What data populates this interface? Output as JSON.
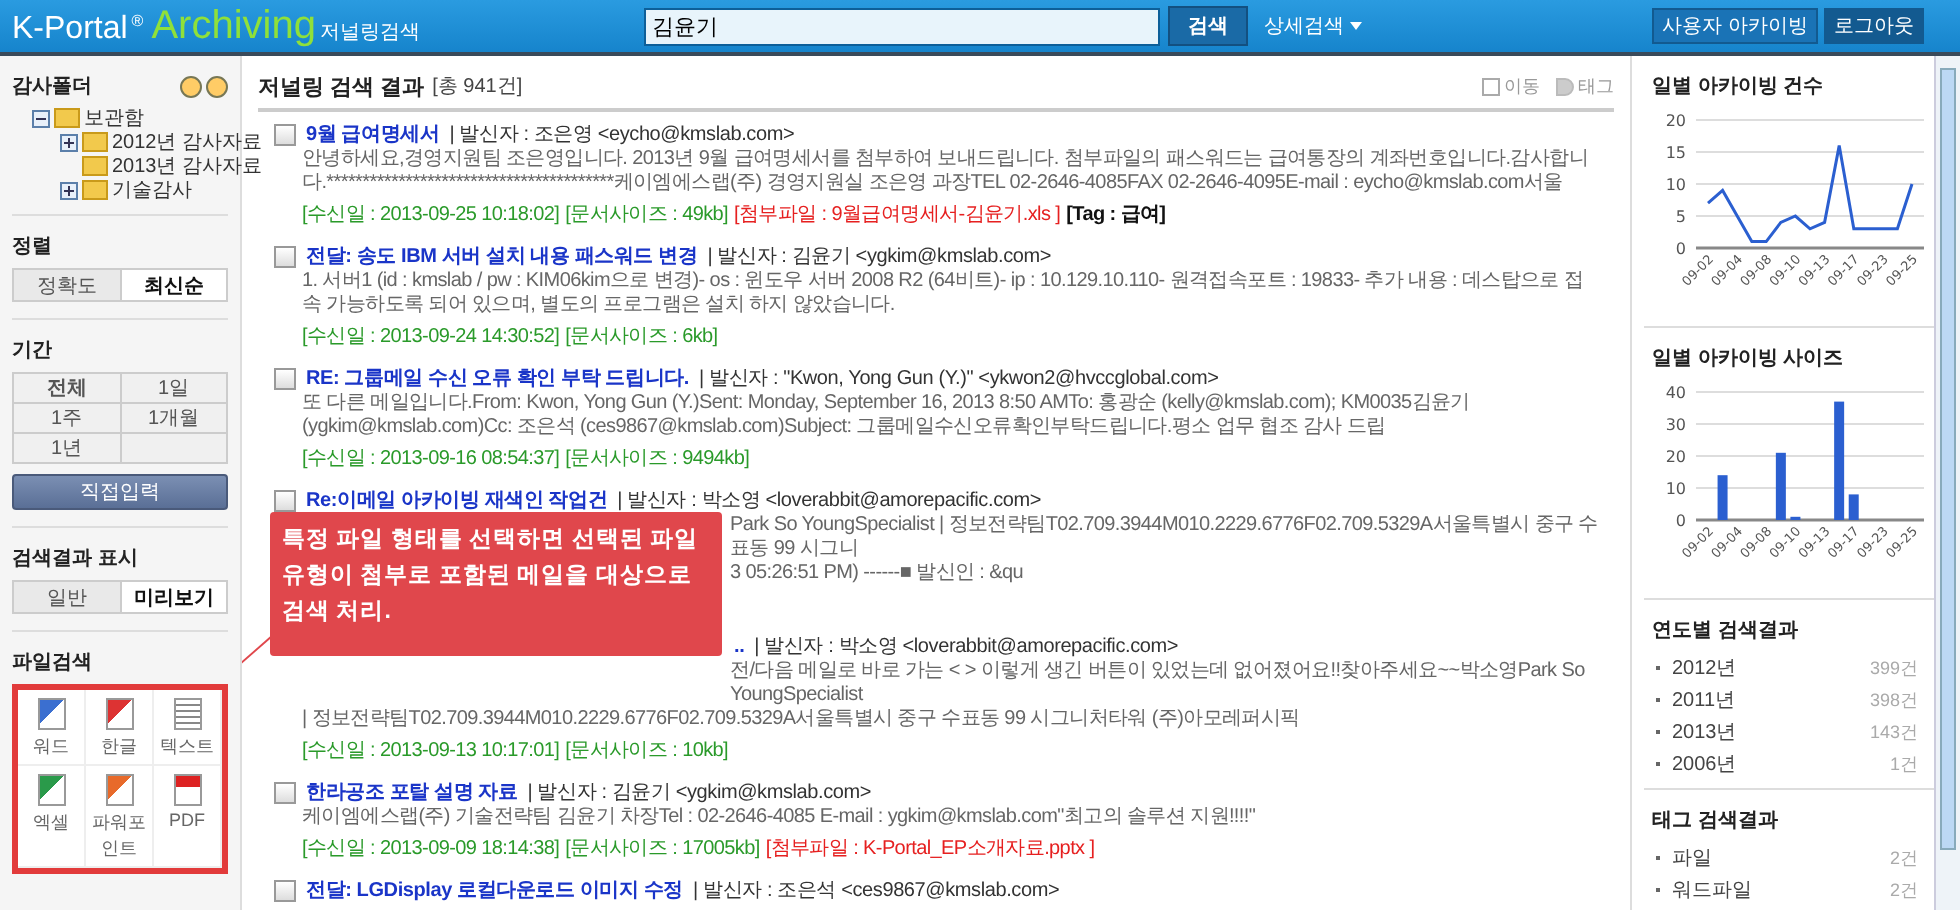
{
  "header": {
    "logo": {
      "brand": "K-Portal",
      "mark": "®",
      "product": "Archiving",
      "subtitle": "저널링검색"
    },
    "search": {
      "value": "김윤기"
    },
    "search_button": "검색",
    "advanced_search": "상세검색",
    "buttons": [
      "사용자 아카이빙",
      "로그아웃"
    ]
  },
  "sidebar": {
    "folders": {
      "title": "감사폴더",
      "tree": [
        {
          "label": "보관함",
          "expanded": true,
          "children": [
            {
              "label": "2012년 감사자료",
              "expanded": false
            },
            {
              "label": "2013년 감사자료"
            },
            {
              "label": "기술감사",
              "expanded": false
            }
          ]
        }
      ]
    },
    "sort": {
      "title": "정렬",
      "options": [
        {
          "label": "정확도",
          "selected": false
        },
        {
          "label": "최신순",
          "selected": true
        }
      ]
    },
    "period": {
      "title": "기간",
      "options": [
        {
          "label": "전체",
          "selected": true
        },
        {
          "label": "1일",
          "selected": false
        },
        {
          "label": "1주",
          "selected": false
        },
        {
          "label": "1개월",
          "selected": false
        },
        {
          "label": "1년",
          "selected": false
        }
      ],
      "custom_button": "직접입력"
    },
    "display": {
      "title": "검색결과 표시",
      "options": [
        {
          "label": "일반",
          "selected": false
        },
        {
          "label": "미리보기",
          "selected": true
        }
      ]
    },
    "file_search": {
      "title": "파일검색",
      "types": [
        {
          "kind": "word",
          "label": "워드"
        },
        {
          "kind": "hangul",
          "label": "한글"
        },
        {
          "kind": "text",
          "label": "텍스트"
        },
        {
          "kind": "excel",
          "label": "엑셀"
        },
        {
          "kind": "powerpoint",
          "label": "파워포인트"
        },
        {
          "kind": "pdf",
          "label": "PDF"
        }
      ]
    }
  },
  "main": {
    "title": "저널링 검색 결과",
    "count": "[총 941건]",
    "actions": [
      "이동",
      "태그"
    ],
    "results": [
      {
        "title": "9월 급여명세서",
        "checked": false,
        "sender": "| 발신자 : 조은영 <eycho@kmslab.com>",
        "body": [
          {
            "text": "안녕하세요,경영지원팀 조은영입니다. 2013년 9월 급여명세서를 첨부하여 보내드립니다. 첨부파일의 패스워드는 급여통장의 계좌번호입니다.감사합니다.****************************************케이엠에스랩(주) 경영지원실 조은영 과장TEL 02-2646-4085FAX 02-2646-4095E-mail : eycho@kmslab.com서울"
          }
        ],
        "meta": [
          {
            "kind": "info",
            "text": "[수신일 : 2013-09-25 10:18:02]"
          },
          {
            "kind": "info",
            "text": "[문서사이즈 : 49kb]"
          },
          {
            "kind": "attachment",
            "text": "[첨부파일 : 9월급여명세서-김윤기.xls ]"
          },
          {
            "kind": "tag",
            "text": "[Tag : 급여]"
          }
        ]
      },
      {
        "title": "전달: 송도 IBM 서버 설치 내용 패스워드 변경",
        "checked": false,
        "sender": "| 발신자 : 김윤기 <ygkim@kmslab.com>",
        "body": [
          {
            "text": "1. 서버1 (id : kmslab / pw : KIM06kim으로 변경)- os : 윈도우 서버 2008 R2 (64비트)- ip : 10.129.10.110- 원격접속포트 : 19833- 추가 내용 : 데스탑으로 접속 가능하도록 되어 있으며, 별도의 프로그램은 설치 하지 않았습니다."
          }
        ],
        "meta": [
          {
            "kind": "info",
            "text": "[수신일 : 2013-09-24 14:30:52]"
          },
          {
            "kind": "info",
            "text": "[문서사이즈 : 6kb]"
          }
        ]
      },
      {
        "title": "RE: 그룹메일 수신 오류 확인 부탁 드립니다.",
        "checked": false,
        "sender": "| 발신자 : \"Kwon, Yong Gun (Y.)\" <ykwon2@hvccglobal.com>",
        "body": [
          {
            "text": "또 다른 메일입니다.From: Kwon, Yong Gun (Y.)Sent: Monday, September 16, 2013 8:50 AMTo: 홍광순 (kelly@kmslab.com); KM0035김윤기 (ygkim@kmslab.com)Cc: 조은석 (ces9867@kmslab.com)Subject: 그룹메일수신오류확인부탁드립니다.평소 업무 협조 감사 드립"
          }
        ],
        "meta": [
          {
            "kind": "info",
            "text": "[수신일 : 2013-09-16 08:54:37]"
          },
          {
            "kind": "info",
            "text": "[문서사이즈 : 9494kb]"
          }
        ]
      },
      {
        "kind": "callout_anchor",
        "title": "Re:이메일 아카이빙 재색인 작업건",
        "checked": false,
        "sender": "| 발신자 : 박소영 <loverabbit@amorepacific.com>",
        "body": [
          {
            "text": "Park So YoungSpecialist | 정보전략팀T02.709.3944M010.2229.6776F02.709.5329A서울특별시 중구 수표동 99 시그니",
            "kind": "after_callout"
          },
          {
            "text": "3 05:26:51 PM) ------■ 발신인 : &qu",
            "kind": "after_callout"
          }
        ]
      },
      {
        "kind": "after_callout",
        "title": "..",
        "sender": "| 발신자 : 박소영 <loverabbit@amorepacific.com>",
        "body": [
          {
            "text": "전/다음 메일로 바로 가는 < > 이렇게 생긴 버튼이 있었는데 없어졌어요!!찾아주세요~~박소영Park So YoungSpecialist",
            "kind": "after_callout"
          },
          {
            "text": "| 정보전략팀T02.709.3944M010.2229.6776F02.709.5329A서울특별시 중구 수표동 99 시그니처타워 (주)아모레퍼시픽"
          }
        ],
        "meta": [
          {
            "kind": "info",
            "text": "[수신일 : 2013-09-13 10:17:01]"
          },
          {
            "kind": "info",
            "text": "[문서사이즈 : 10kb]"
          }
        ]
      },
      {
        "title": "한라공조 포탈 설명 자료",
        "checked": false,
        "sender": "| 발신자 : 김윤기 <ygkim@kmslab.com>",
        "body": [
          {
            "text": "케이엠에스랩(주) 기술전략팀 김윤기 차장Tel : 02-2646-4085 E-mail : ygkim@kmslab.com\"최고의 솔루션 지원!!!!\""
          }
        ],
        "meta": [
          {
            "kind": "info",
            "text": "[수신일 : 2013-09-09 18:14:38]"
          },
          {
            "kind": "info",
            "text": "[문서사이즈 : 17005kb]"
          },
          {
            "kind": "attachment",
            "text": "[첨부파일 : K-Portal_EP소개자료.pptx ]"
          }
        ]
      },
      {
        "title": "전달: LGDisplay 로컬다운로드 이미지 수정",
        "checked": false,
        "sender": "| 발신자 : 조은석 <ces9867@kmslab.com>"
      }
    ],
    "callout": "특정 파일 형태를 선택하면 선택된 파일 유형이 첨부로 포함된 메일을 대상으로 검색 처리."
  },
  "right": {
    "charts": [
      {
        "chart_data": {
          "type": "line",
          "title": "일별 아카이빙 건수",
          "categories": [
            "09-02",
            null,
            "09-04",
            null,
            "09-08",
            null,
            "09-10",
            null,
            "09-13",
            null,
            "09-17",
            null,
            "09-23",
            null,
            "09-25"
          ],
          "series": [
            {
              "color": "#2b5fd0",
              "values": [
                7,
                9,
                5,
                1,
                1,
                4,
                5,
                3,
                4,
                16,
                3,
                3,
                3,
                3,
                10
              ]
            }
          ],
          "grid": true,
          "ylim": [
            0,
            20
          ],
          "yticks": [
            0,
            5,
            10,
            15,
            20
          ]
        }
      },
      {
        "chart_data": {
          "type": "bar",
          "title": "일별 아카이빙 사이즈",
          "categories": [
            "09-02",
            null,
            "09-04",
            null,
            "09-08",
            null,
            "09-10",
            null,
            "09-13",
            null,
            "09-17",
            null,
            "09-23",
            null,
            "09-25"
          ],
          "series": [
            {
              "color": "#2b5fd0",
              "values": [
                0,
                14,
                0,
                0,
                0,
                21,
                1,
                0,
                0,
                37,
                8,
                0,
                0,
                0,
                0
              ]
            }
          ],
          "grid": true,
          "ylim": [
            0,
            40
          ],
          "yticks": [
            0,
            10,
            20,
            30,
            40
          ]
        }
      }
    ],
    "lists": [
      {
        "title": "연도별 검색결과",
        "items": [
          {
            "label": "2012년",
            "count": "399건"
          },
          {
            "label": "2011년",
            "count": "398건"
          },
          {
            "label": "2013년",
            "count": "143건"
          },
          {
            "label": "2006년",
            "count": "1건"
          }
        ]
      },
      {
        "title": "태그 검색결과",
        "items": [
          {
            "label": "파일",
            "count": "2건"
          },
          {
            "label": "워드파일",
            "count": "2건"
          }
        ]
      }
    ]
  }
}
